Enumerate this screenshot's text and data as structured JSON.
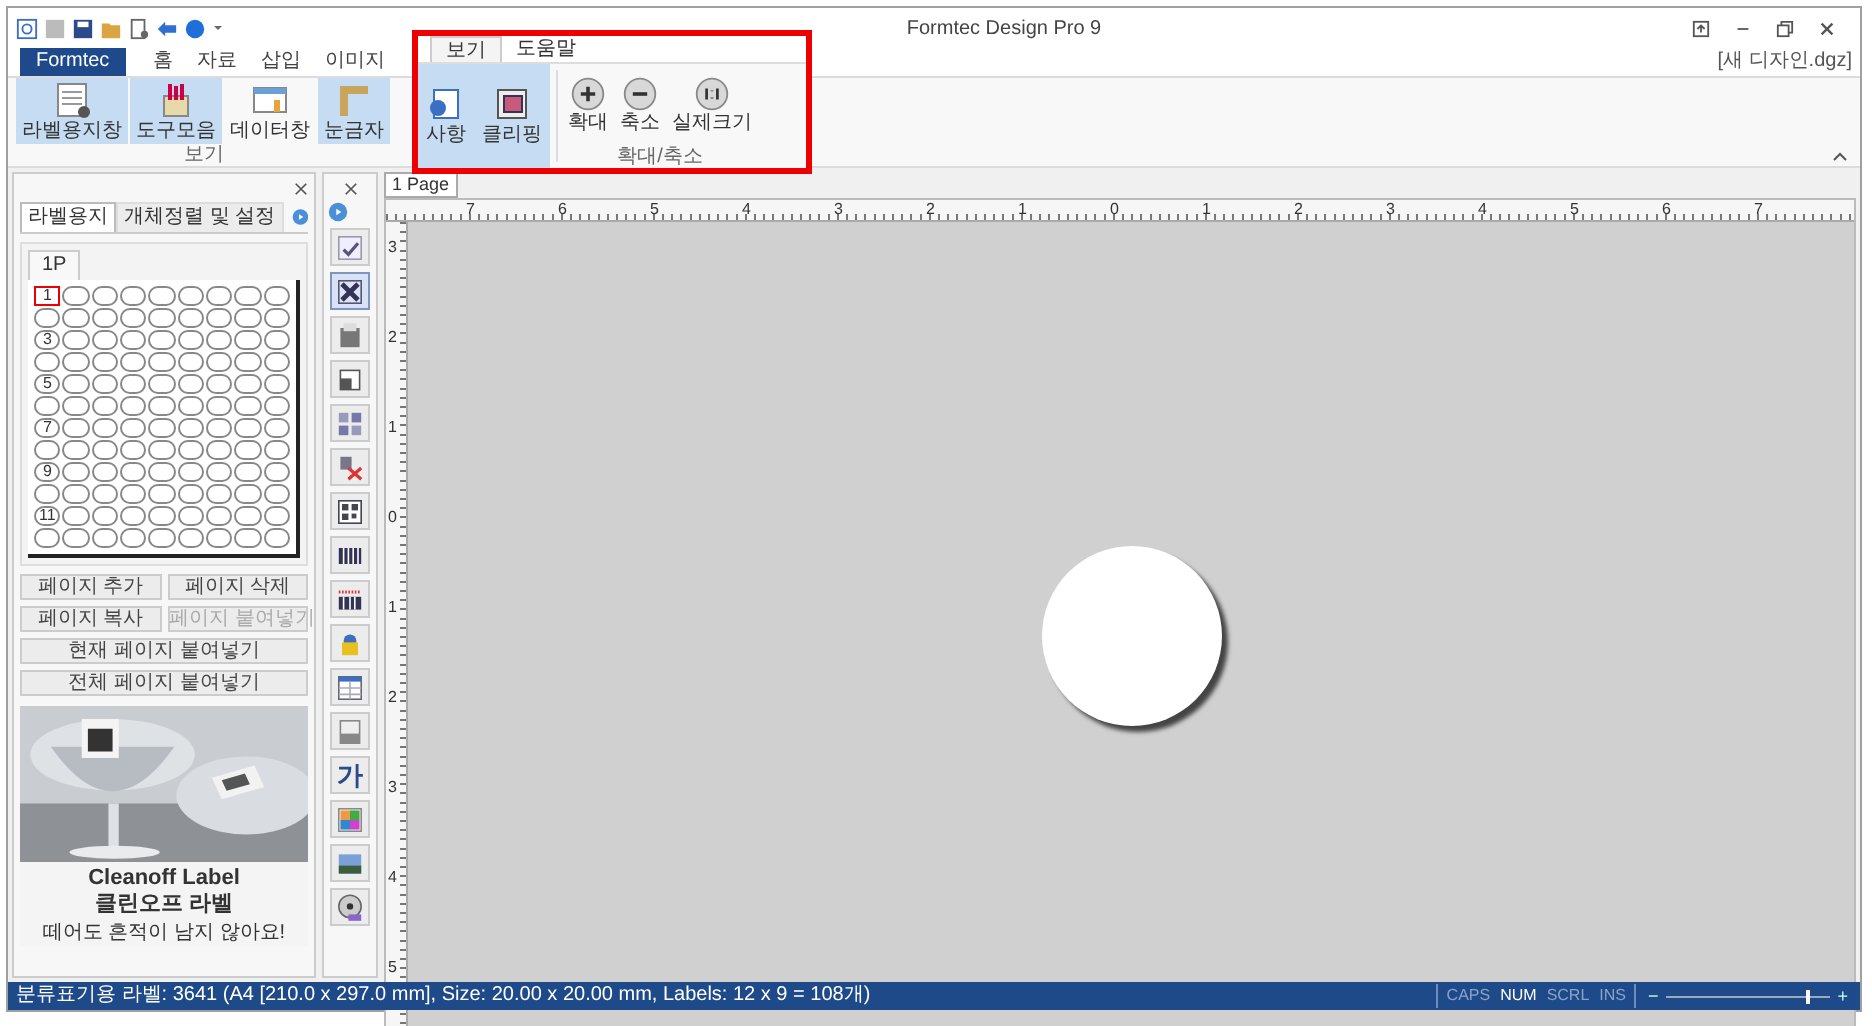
{
  "window": {
    "title": "Formtec Design Pro 9",
    "document": "[새 디자인.dgz]"
  },
  "ribbon": {
    "tabs": [
      {
        "label": "Formtec",
        "kind": "app",
        "selected": false
      },
      {
        "label": "홈",
        "kind": "tab",
        "selected": false
      },
      {
        "label": "자료",
        "kind": "tab",
        "selected": false
      },
      {
        "label": "삽입",
        "kind": "tab",
        "selected": false
      },
      {
        "label": "이미지",
        "kind": "tab",
        "selected": false
      }
    ],
    "buttons": [
      {
        "label": "라벨용지창",
        "on": true
      },
      {
        "label": "도구모음",
        "on": true
      },
      {
        "label": "데이터창",
        "on": false
      },
      {
        "label": "눈금자",
        "on": true
      }
    ],
    "group": "보기"
  },
  "popup": {
    "tabs": [
      {
        "label": "보기",
        "selected": true
      },
      {
        "label": "도움말",
        "selected": false
      }
    ],
    "buttons": [
      {
        "label": "사항",
        "on": true
      },
      {
        "label": "클리핑",
        "on": true
      }
    ],
    "zoom_buttons": [
      {
        "label": "확대"
      },
      {
        "label": "축소"
      },
      {
        "label": "실제크기"
      }
    ],
    "group": "확대/축소"
  },
  "left_panel": {
    "tabs": [
      {
        "label": "라벨용지",
        "selected": true
      },
      {
        "label": "개체정렬 및 설정",
        "selected": false
      }
    ],
    "page_tab": "1P",
    "rows": [
      {
        "number": "1",
        "selected": true
      },
      {
        "selected": false
      },
      {
        "number": "3",
        "selected": false
      },
      {
        "selected": false
      },
      {
        "number": "5",
        "selected": false
      },
      {
        "selected": false
      },
      {
        "number": "7",
        "selected": false
      },
      {
        "selected": false
      },
      {
        "number": "9",
        "selected": false
      },
      {
        "selected": false
      },
      {
        "number": "11",
        "selected": false
      },
      {
        "selected": false
      }
    ],
    "buttons": [
      {
        "label": "페이지 추가",
        "disabled": false,
        "kind": "half"
      },
      {
        "label": "페이지 삭제",
        "disabled": false,
        "kind": "half"
      },
      {
        "label": "페이지 복사",
        "disabled": false,
        "kind": "half"
      },
      {
        "label": "페이지 붙여넣기",
        "disabled": true,
        "kind": "half"
      },
      {
        "label": "현재 페이지 붙여넣기",
        "disabled": false,
        "kind": "full"
      },
      {
        "label": "전체 페이지 붙여넣기",
        "disabled": false,
        "kind": "full"
      }
    ],
    "ad": {
      "brand": "Cleanoff Label",
      "brand_ko": "클린오프 라벨",
      "tagline": "떼어도 흔적이 남지 않아요!"
    }
  },
  "tools": [
    {
      "kind": "check",
      "selected": false
    },
    {
      "kind": "select",
      "selected": true
    },
    {
      "kind": "textbox",
      "selected": false
    },
    {
      "kind": "image-edit",
      "selected": false
    },
    {
      "kind": "shape-text",
      "selected": false
    },
    {
      "kind": "text-style",
      "selected": false
    },
    {
      "kind": "qr",
      "selected": false
    },
    {
      "kind": "barcode",
      "selected": false
    },
    {
      "kind": "barcode-red",
      "selected": false
    },
    {
      "kind": "lock",
      "selected": false
    },
    {
      "kind": "table",
      "selected": false
    },
    {
      "kind": "page",
      "selected": false
    },
    {
      "kind": "text",
      "label": "가",
      "selected": false
    },
    {
      "kind": "chart",
      "selected": false
    },
    {
      "kind": "picture",
      "selected": false
    },
    {
      "kind": "disc",
      "selected": false
    }
  ],
  "canvas": {
    "page_tab": "1 Page",
    "top_ruler": [
      "7",
      "6",
      "5",
      "4",
      "3",
      "2",
      "1",
      "0",
      "1",
      "2",
      "3",
      "4",
      "5",
      "6",
      "7"
    ],
    "left_ruler": [
      "3",
      "2",
      "1",
      "0",
      "1",
      "2",
      "3",
      "4",
      "5"
    ]
  },
  "status_bar": {
    "text": "분류표기용 라벨: 3641 (A4 [210.0 x 297.0 mm], Size: 20.00 x 20.00 mm,  Labels: 12 x 9 = 108개)",
    "indicators": [
      {
        "label": "CAPS",
        "on": false
      },
      {
        "label": "NUM",
        "on": true
      },
      {
        "label": "SCRL",
        "on": false
      },
      {
        "label": "INS",
        "on": false
      }
    ],
    "zoom": {
      "minus": "−",
      "plus": "+",
      "level": 0.85
    }
  }
}
